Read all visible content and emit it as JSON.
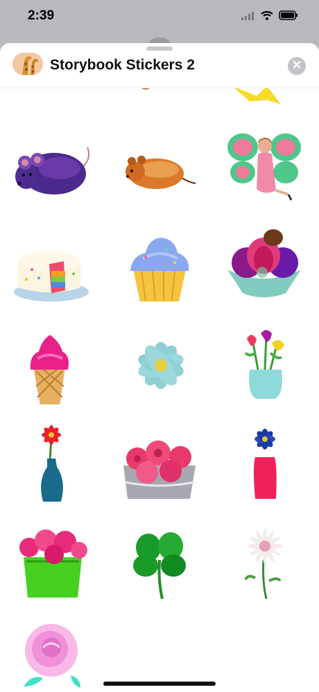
{
  "status_bar": {
    "time": "2:39"
  },
  "sheet": {
    "title": "Storybook Stickers 2",
    "app_icon": "giraffe-icon",
    "close_icon": "close-icon"
  },
  "stickers": [
    {
      "name": "sticker-purple-mouse",
      "icon": "purple-mouse"
    },
    {
      "name": "sticker-orange-hamster",
      "icon": "orange-hamster"
    },
    {
      "name": "sticker-fairy",
      "icon": "fairy"
    },
    {
      "name": "sticker-rainbow-cake",
      "icon": "rainbow-cake"
    },
    {
      "name": "sticker-cupcake",
      "icon": "cupcake"
    },
    {
      "name": "sticker-sundae-bowl",
      "icon": "sundae-bowl"
    },
    {
      "name": "sticker-ice-cream-cone",
      "icon": "ice-cream-cone"
    },
    {
      "name": "sticker-blue-daisy",
      "icon": "blue-daisy"
    },
    {
      "name": "sticker-tulip-vase",
      "icon": "tulip-vase"
    },
    {
      "name": "sticker-red-flower-vase",
      "icon": "red-flower-vase"
    },
    {
      "name": "sticker-rose-box",
      "icon": "rose-box"
    },
    {
      "name": "sticker-pink-vase-blue-flower",
      "icon": "pink-vase-blue-flower"
    },
    {
      "name": "sticker-green-pot-flowers",
      "icon": "green-pot-flowers"
    },
    {
      "name": "sticker-clover",
      "icon": "clover"
    },
    {
      "name": "sticker-white-chrysanthemum",
      "icon": "white-chrysanthemum"
    },
    {
      "name": "sticker-pink-rose",
      "icon": "pink-rose"
    }
  ],
  "colors": {
    "sheet_background": "#ffffff",
    "backdrop": "#b9b9bd",
    "close_button": "#c4c4c8"
  }
}
